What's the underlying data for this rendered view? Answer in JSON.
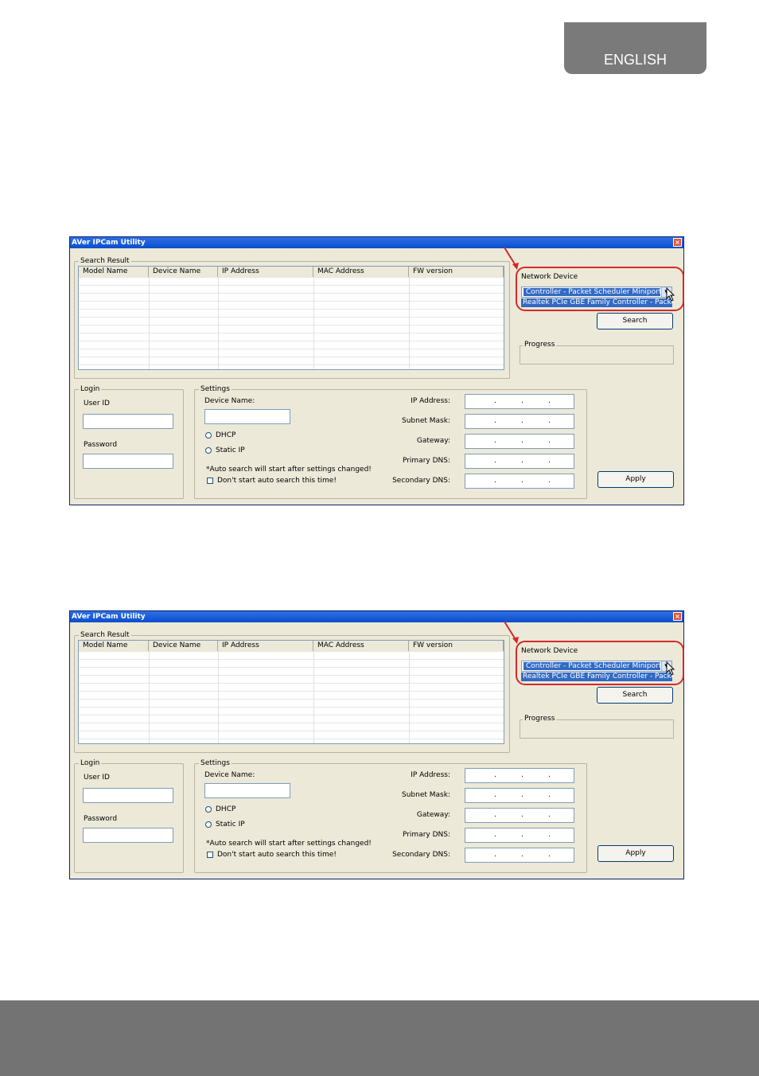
{
  "header": {
    "language_tab": "ENGLISH"
  },
  "windows": [
    {
      "title": "AVer IPCam Utility",
      "search_result": {
        "legend": "Search Result",
        "columns": [
          "Model Name",
          "Device Name",
          "IP Address",
          "MAC Address",
          "FW version"
        ]
      },
      "network_device": {
        "legend": "Network Device",
        "selected": "Controller - Packet Scheduler Miniport",
        "dropdown_option": "Realtek PCIe GBE Family Controller - Packet"
      },
      "search_button": "Search",
      "progress_legend": "Progress",
      "login": {
        "legend": "Login",
        "user_id_label": "User ID",
        "password_label": "Password"
      },
      "settings": {
        "legend": "Settings",
        "device_name_label": "Device Name:",
        "dhcp_label": "DHCP",
        "static_ip_label": "Static IP",
        "auto_search_note": "*Auto search will start after settings changed!",
        "dont_start_label": "Don't start auto search this time!",
        "ip_address_label": "IP Address:",
        "subnet_mask_label": "Subnet Mask:",
        "gateway_label": "Gateway:",
        "primary_dns_label": "Primary DNS:",
        "secondary_dns_label": "Secondary DNS:"
      },
      "apply_button": "Apply"
    },
    {
      "title": "AVer IPCam Utility",
      "search_result": {
        "legend": "Search Result",
        "columns": [
          "Model Name",
          "Device Name",
          "IP Address",
          "MAC Address",
          "FW version"
        ]
      },
      "network_device": {
        "legend": "Network Device",
        "selected": "Controller - Packet Scheduler Miniport",
        "dropdown_option": "Realtek PCIe GBE Family Controller - Packet"
      },
      "search_button": "Search",
      "progress_legend": "Progress",
      "login": {
        "legend": "Login",
        "user_id_label": "User ID",
        "password_label": "Password"
      },
      "settings": {
        "legend": "Settings",
        "device_name_label": "Device Name:",
        "dhcp_label": "DHCP",
        "static_ip_label": "Static IP",
        "auto_search_note": "*Auto search will start after settings changed!",
        "dont_start_label": "Don't start auto search this time!",
        "ip_address_label": "IP Address:",
        "subnet_mask_label": "Subnet Mask:",
        "gateway_label": "Gateway:",
        "primary_dns_label": "Primary DNS:",
        "secondary_dns_label": "Secondary DNS:"
      },
      "apply_button": "Apply"
    }
  ],
  "colors": {
    "highlight": "#d42a2a",
    "titlebar": "#0a4ecb",
    "footer_band": "#737373",
    "tab": "#7a7a7a"
  }
}
